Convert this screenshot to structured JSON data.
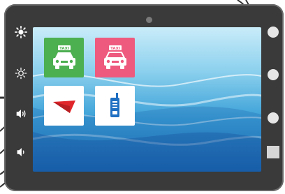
{
  "device": {
    "frame_color": "#3a3a3a",
    "screen_colors": [
      "#c9ecf9",
      "#3ea2d8",
      "#1e6fb8"
    ]
  },
  "left_controls": [
    {
      "name": "brightness-up",
      "icon": "sun-bold-icon"
    },
    {
      "name": "brightness-down",
      "icon": "sun-outline-icon"
    },
    {
      "name": "volume-up",
      "icon": "speaker-waves-icon"
    },
    {
      "name": "volume-down",
      "icon": "speaker-icon"
    }
  ],
  "right_controls": [
    {
      "name": "round-button-1",
      "icon": "circle"
    },
    {
      "name": "round-button-2",
      "icon": "circle"
    },
    {
      "name": "round-button-3",
      "icon": "circle"
    },
    {
      "name": "square-button",
      "icon": "square"
    }
  ],
  "apps": [
    {
      "name": "taxi-green",
      "badge": "TAXI",
      "bg": "#4caf50"
    },
    {
      "name": "taxi-pink",
      "badge": "TAXI",
      "bg": "#ee5a7e"
    },
    {
      "name": "red-arrow",
      "bg": "#ffffff",
      "accent": "#e0262a"
    },
    {
      "name": "walkie-talkie",
      "bg": "#ffffff",
      "accent": "#1f6fc2"
    }
  ]
}
